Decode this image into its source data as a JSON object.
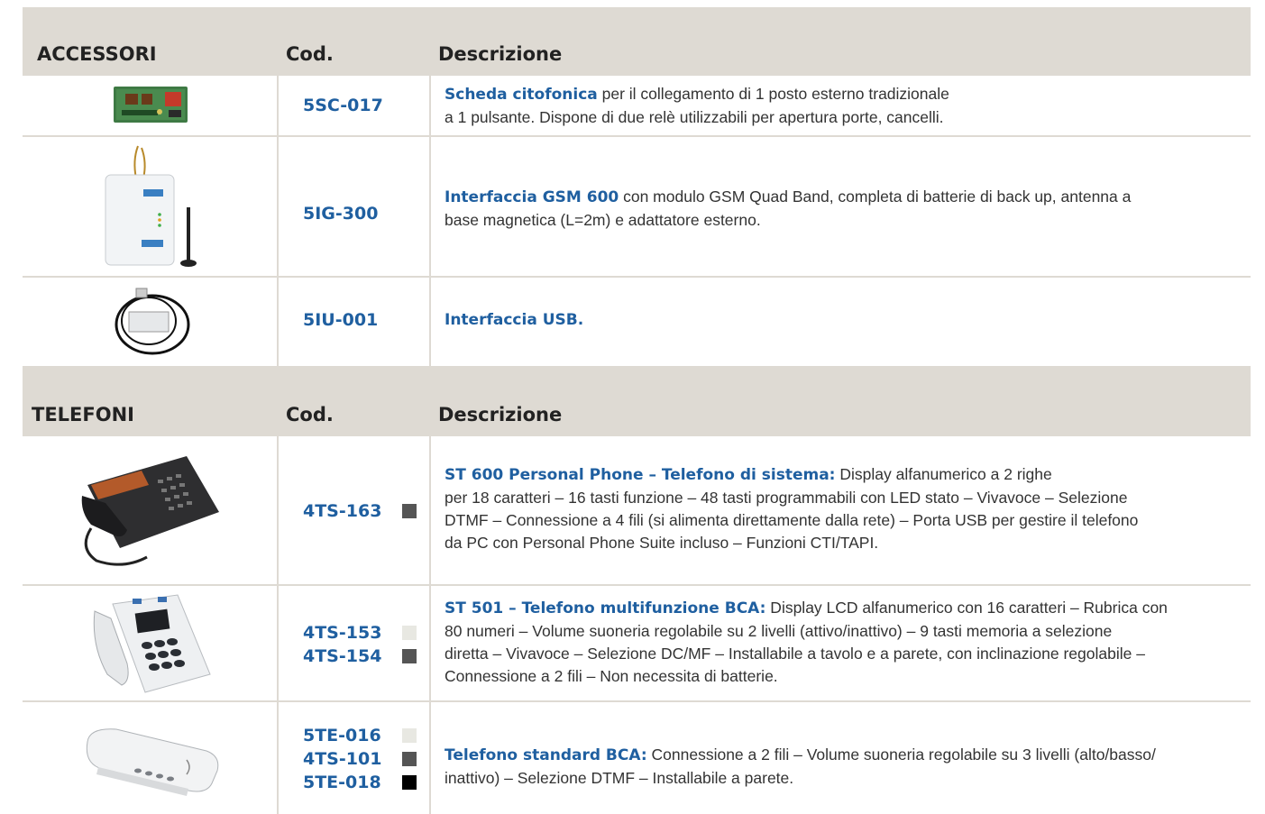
{
  "sections": [
    {
      "title": "ACCESSORI",
      "col_code": "Cod.",
      "col_desc": "Descrizione",
      "rows": [
        {
          "image": "intercom-board-image",
          "codes": [
            {
              "code": "5SC-017",
              "swatch": null
            }
          ],
          "title": "Scheda citofonica",
          "text_lines": [
            " per il collegamento di 1 posto esterno tradizionale",
            "a 1 pulsante. Dispone di due relè utilizzabili per apertura porte, cancelli."
          ]
        },
        {
          "image": "gsm-interface-image",
          "codes": [
            {
              "code": "5IG-300",
              "swatch": null
            }
          ],
          "title": "Interfaccia GSM 600",
          "text_lines": [
            " con modulo GSM Quad Band, completa di batterie di back up, antenna a",
            "base magnetica (L=2m) e adattatore esterno."
          ]
        },
        {
          "image": "usb-interface-image",
          "codes": [
            {
              "code": "5IU-001",
              "swatch": null
            }
          ],
          "title": "Interfaccia USB.",
          "text_lines": []
        }
      ]
    },
    {
      "title": "TELEFONI",
      "col_code": "Cod.",
      "col_desc": "Descrizione",
      "rows": [
        {
          "image": "system-phone-image",
          "codes": [
            {
              "code": "4TS-163",
              "swatch": "#555555"
            }
          ],
          "title": "ST 600 Personal Phone – Telefono di sistema:",
          "text_lines": [
            " Display alfanumerico a 2 righe",
            "per 18 caratteri – 16 tasti funzione – 48 tasti programmabili con LED stato – Vivavoce – Selezione",
            "DTMF – Connessione a 4 fili (si alimenta direttamente dalla rete) – Porta USB per gestire il telefono",
            "da PC con Personal Phone Suite incluso – Funzioni CTI/TAPI."
          ]
        },
        {
          "image": "multifunction-phone-image",
          "codes": [
            {
              "code": "4TS-153",
              "swatch": "#e8e8e2"
            },
            {
              "code": "4TS-154",
              "swatch": "#555555"
            }
          ],
          "title": "ST 501 – Telefono multifunzione BCA:",
          "text_lines": [
            " Display LCD alfanumerico con 16 caratteri –  Rubrica con",
            "80 numeri – Volume suoneria regolabile su 2 livelli (attivo/inattivo) – 9 tasti memoria a selezione",
            "diretta – Vivavoce – Selezione DC/MF – Installabile a tavolo e a parete, con inclinazione regolabile –",
            "Connessione a 2 fili – Non necessita di batterie."
          ]
        },
        {
          "image": "standard-phone-image",
          "codes": [
            {
              "code": "5TE-016",
              "swatch": "#e8e8e2"
            },
            {
              "code": "4TS-101",
              "swatch": "#555555"
            },
            {
              "code": "5TE-018",
              "swatch": "#000000"
            }
          ],
          "title": "Telefono standard BCA:",
          "text_lines": [
            " Connessione a 2 fili – Volume suoneria regolabile su 3 livelli (alto/basso/",
            "inattivo) – Selezione DTMF – Installabile a parete."
          ]
        }
      ]
    }
  ]
}
